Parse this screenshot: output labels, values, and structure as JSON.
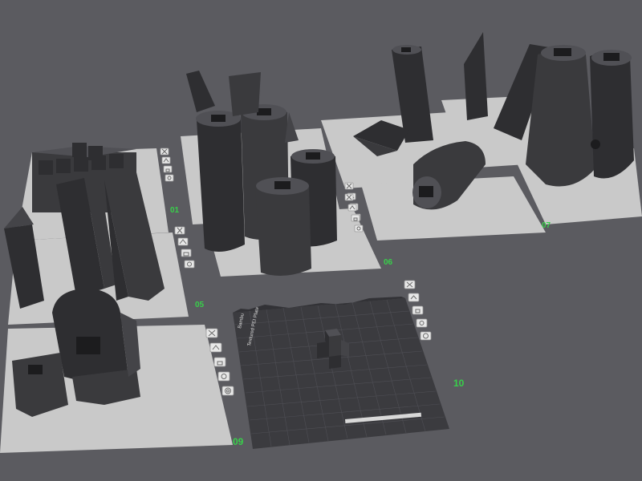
{
  "scene": {
    "background_color": "#5b5b60",
    "plate_color": "#c9c9c9",
    "plate_number_color": "#38d04a",
    "model_color": "#333336"
  },
  "plates": [
    {
      "id": "01",
      "label": "01"
    },
    {
      "id": "05",
      "label": "05"
    },
    {
      "id": "06",
      "label": "06"
    },
    {
      "id": "07",
      "label": "07"
    },
    {
      "id": "09",
      "label": "09"
    },
    {
      "id": "10",
      "label": "10"
    }
  ],
  "plate_buttons": {
    "icons": [
      "close-icon",
      "arrange-icon",
      "lock-icon",
      "settings-icon"
    ]
  },
  "active_bed": {
    "top_label": "Textured PEI Plate",
    "side_label": "Bambu"
  }
}
